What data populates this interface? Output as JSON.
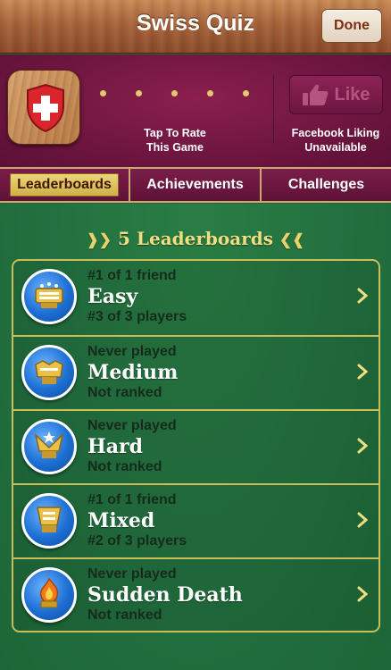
{
  "navbar": {
    "title": "Swiss Quiz",
    "done_label": "Done"
  },
  "header": {
    "rate_text_line1": "Tap To Rate",
    "rate_text_line2": "This Game",
    "like_label": "Like",
    "fb_text_line1": "Facebook Liking",
    "fb_text_line2": "Unavailable",
    "rating_dots": 5
  },
  "tabs": [
    {
      "label": "Leaderboards",
      "active": true
    },
    {
      "label": "Achievements",
      "active": false
    },
    {
      "label": "Challenges",
      "active": false
    }
  ],
  "section_title": "5 Leaderboards",
  "leaderboards": [
    {
      "top": "#1 of 1 friend",
      "name": "Easy",
      "bottom": "#3 of 3 players",
      "icon": "easy-medal-icon"
    },
    {
      "top": "Never played",
      "name": "Medium",
      "bottom": "Not ranked",
      "icon": "medium-medal-icon"
    },
    {
      "top": "Never played",
      "name": "Hard",
      "bottom": "Not ranked",
      "icon": "hard-medal-icon"
    },
    {
      "top": "#1 of 1 friend",
      "name": "Mixed",
      "bottom": "#2 of 3 players",
      "icon": "mixed-medal-icon"
    },
    {
      "top": "Never played",
      "name": "Sudden Death",
      "bottom": "Not ranked",
      "icon": "sudden-death-medal-icon"
    }
  ],
  "colors": {
    "felt_green": "#237140",
    "header_maroon": "#701641",
    "gold": "#c9be57",
    "title_gold": "#f0de82"
  }
}
